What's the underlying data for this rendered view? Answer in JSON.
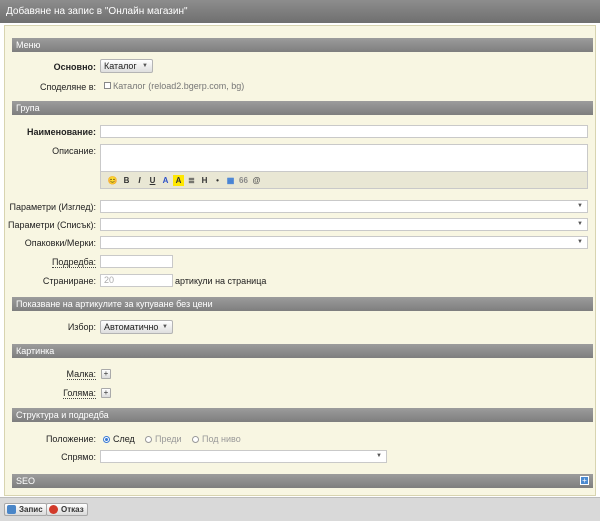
{
  "window": {
    "title": "Добавяне на запис в \"Онлайн магазин\""
  },
  "sections": {
    "menu": "Меню",
    "group": "Група",
    "showing": "Показване на артикулите за купуване без цени",
    "picture": "Картинка",
    "structure": "Структура и подредба",
    "seo": "SEO"
  },
  "menu": {
    "main_label": "Основно:",
    "main_value": "Каталог",
    "share_label": "Споделяне в:",
    "share_option": "Каталог (reload2.bgerp.com, bg)"
  },
  "group": {
    "name_label": "Наименование:",
    "name_value": "",
    "description_label": "Описание:",
    "params_view_label": "Параметри (Изглед):",
    "params_list_label": "Параметри (Списък):",
    "packaging_label": "Опаковки/Мерки:",
    "order_label": "Подредба:",
    "order_value": "",
    "paging_label": "Страниране:",
    "paging_value": "20",
    "paging_suffix": "артикули на страница"
  },
  "editor_toolbar": {
    "smiley": "😊",
    "bold": "B",
    "italic": "I",
    "underline": "U",
    "color": "A",
    "highlight": "A",
    "align": "≣",
    "heading": "H",
    "bullet": "•",
    "table": "▦",
    "quote": "66",
    "attach": "@"
  },
  "showing": {
    "choice_label": "Избор:",
    "choice_value": "Автоматично"
  },
  "picture": {
    "small_label": "Малка:",
    "large_label": "Голяма:",
    "add_symbol": "+"
  },
  "structure": {
    "position_label": "Положение:",
    "options": [
      "След",
      "Преди",
      "Под ниво"
    ],
    "selected": "След",
    "relative_label": "Спрямо:"
  },
  "footer": {
    "save_label": "Запис",
    "cancel_label": "Отказ"
  },
  "colors": {
    "form_bg": "#f8f6e2",
    "section_bg": "#8a8a8a",
    "accent": "#3a7bd5"
  }
}
